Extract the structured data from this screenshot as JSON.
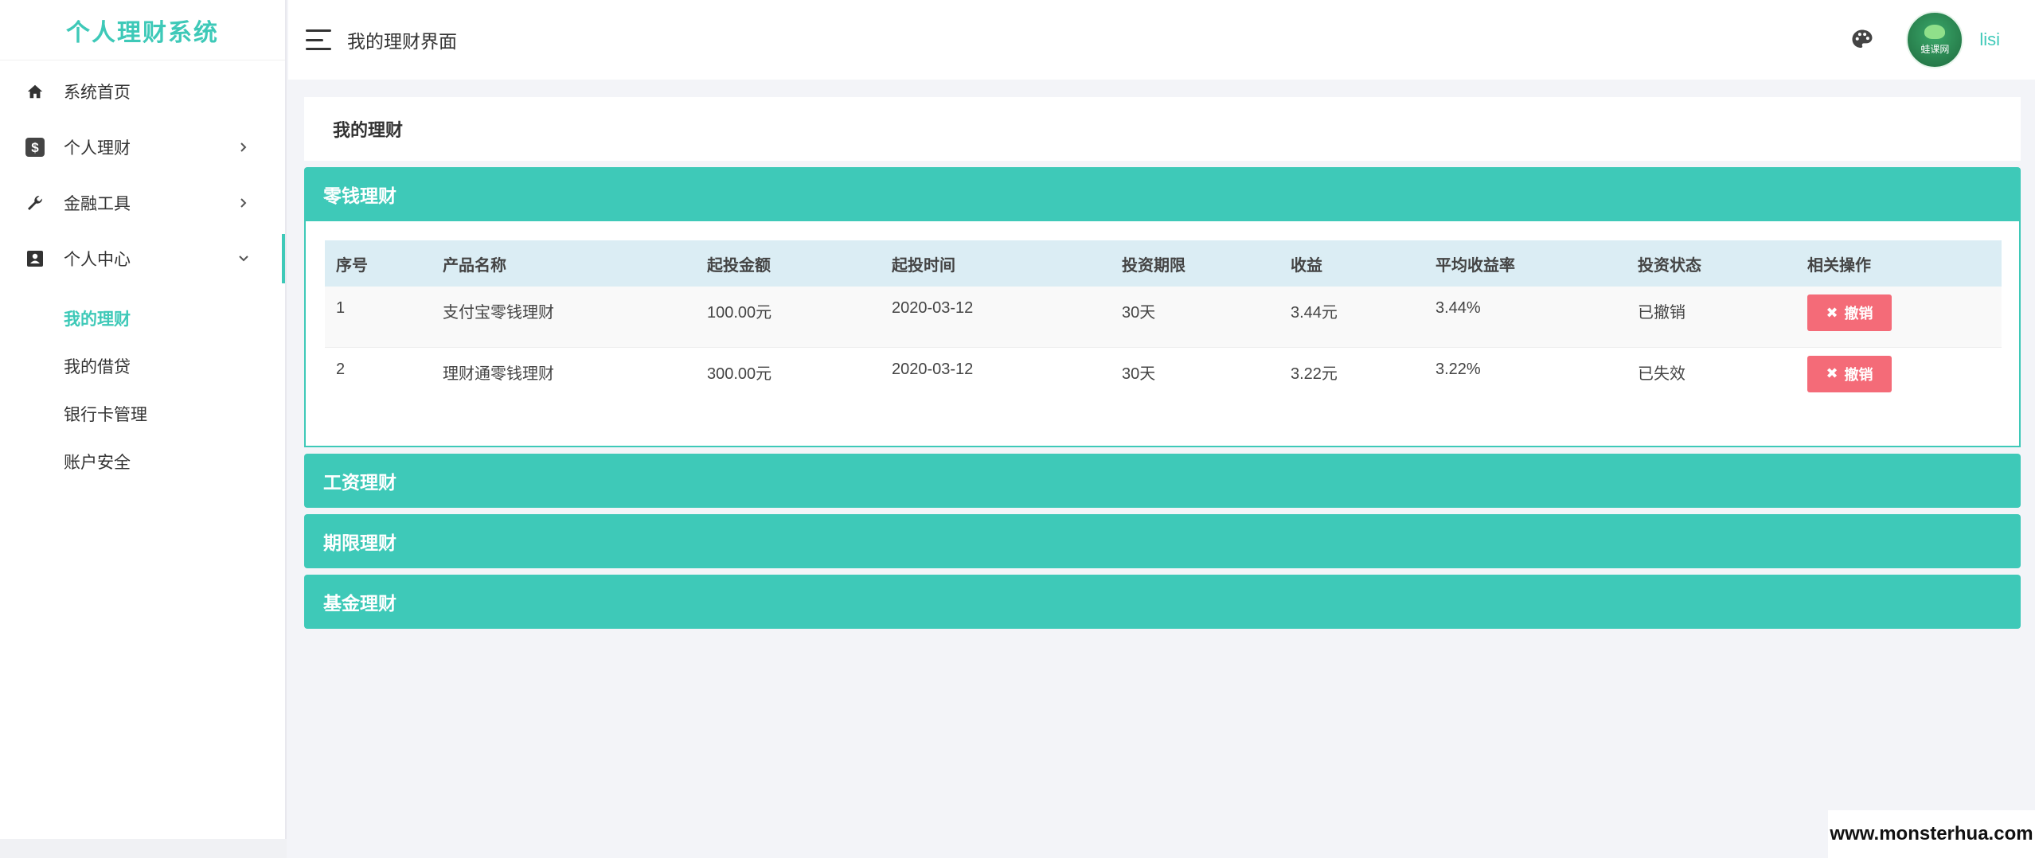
{
  "app": {
    "brand": "个人理财系统"
  },
  "sidebar": {
    "items": [
      {
        "label": "系统首页",
        "icon": "home-icon"
      },
      {
        "label": "个人理财",
        "icon": "dollar-icon"
      },
      {
        "label": "金融工具",
        "icon": "wrench-icon"
      },
      {
        "label": "个人中心",
        "icon": "user-card-icon"
      }
    ],
    "submenu": [
      {
        "label": "我的理财"
      },
      {
        "label": "我的借贷"
      },
      {
        "label": "银行卡管理"
      },
      {
        "label": "账户安全"
      }
    ]
  },
  "header": {
    "title": "我的理财界面",
    "username": "lisi",
    "avatar_text": "蛙课网"
  },
  "main": {
    "page_title": "我的理财",
    "panels": [
      {
        "title": "零钱理财"
      },
      {
        "title": "工资理财"
      },
      {
        "title": "期限理财"
      },
      {
        "title": "基金理财"
      }
    ],
    "table": {
      "columns": [
        "序号",
        "产品名称",
        "起投金额",
        "起投时间",
        "投资期限",
        "收益",
        "平均收益率",
        "投资状态",
        "相关操作"
      ],
      "rows": [
        [
          "1",
          "支付宝零钱理财",
          "100.00元",
          "2020-03-12",
          "30天",
          "3.44元",
          "3.44%",
          "已撤销"
        ],
        [
          "2",
          "理财通零钱理财",
          "300.00元",
          "2020-03-12",
          "30天",
          "3.22元",
          "3.22%",
          "已失效"
        ]
      ],
      "action_label": "撤销"
    }
  },
  "watermark": "www.monsterhua.com",
  "colors": {
    "accent": "#3ec9b8",
    "danger": "#f46b78",
    "table_header": "#dbedf4"
  }
}
